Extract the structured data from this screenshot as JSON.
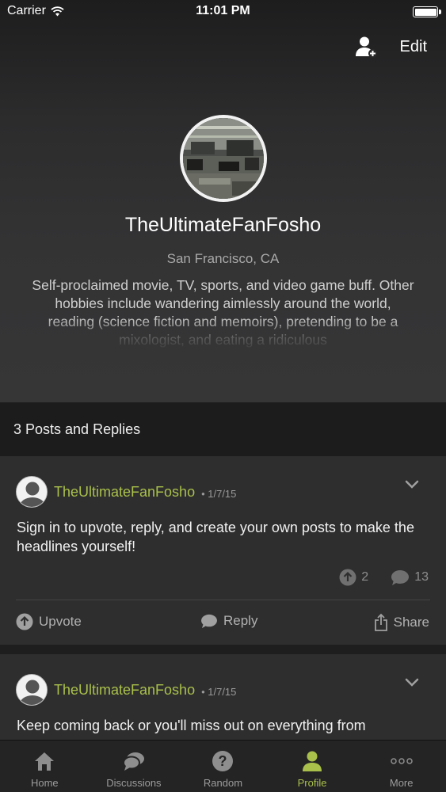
{
  "status_bar": {
    "carrier": "Carrier",
    "time": "11:01 PM"
  },
  "top_actions": {
    "add_friend_icon": "add-user-icon",
    "edit_label": "Edit"
  },
  "profile": {
    "name": "TheUltimateFanFosho",
    "location": "San Francisco, CA",
    "bio": "Self-proclaimed movie, TV, sports, and video game buff. Other hobbies include wandering aimlessly around the world, reading (science fiction and memoirs), pretending to be a mixologist, and eating a ridiculous"
  },
  "posts_section": {
    "header": "3 Posts and Replies"
  },
  "posts": [
    {
      "author": "TheUltimateFanFosho",
      "date": "• 1/7/15",
      "text": "Sign in to upvote, reply, and create your own posts to make the headlines yourself!",
      "upvotes": "2",
      "comments": "13",
      "actions": {
        "upvote": "Upvote",
        "reply": "Reply",
        "share": "Share"
      }
    },
    {
      "author": "TheUltimateFanFosho",
      "date": "• 1/7/15",
      "text": "Keep coming back or you'll miss out on everything from"
    }
  ],
  "tabbar": {
    "items": [
      {
        "label": "Home",
        "icon": "home-icon"
      },
      {
        "label": "Discussions",
        "icon": "discussions-icon"
      },
      {
        "label": "Random",
        "icon": "question-icon"
      },
      {
        "label": "Profile",
        "icon": "profile-icon",
        "active": true
      },
      {
        "label": "More",
        "icon": "more-icon"
      }
    ]
  },
  "colors": {
    "accent": "#a9c04a",
    "background": "#1e1e1f",
    "card": "#2e2e2f"
  }
}
